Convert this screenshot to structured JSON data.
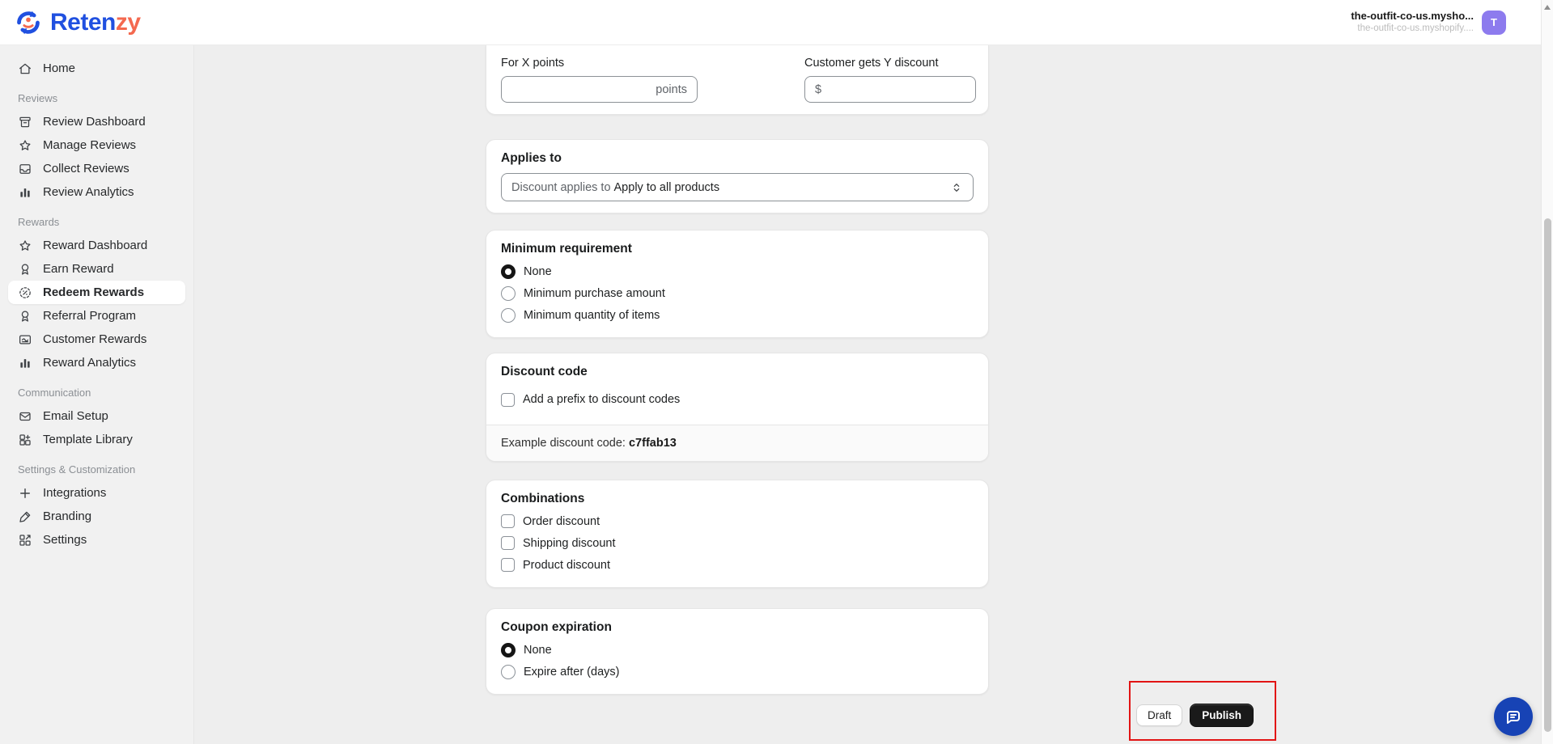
{
  "header": {
    "brand": {
      "name_primary": "Reten",
      "name_accent": "zy"
    },
    "shop": {
      "name": "the-outfit-co-us.mysho...",
      "domain": "the-outfit-co-us.myshopify....",
      "avatar_initial": "T"
    }
  },
  "sidebar": {
    "home": {
      "label": "Home",
      "icon": "home-icon"
    },
    "sections": [
      {
        "title": "Reviews",
        "items": [
          {
            "label": "Review Dashboard",
            "icon": "archive-icon"
          },
          {
            "label": "Manage Reviews",
            "icon": "star-icon"
          },
          {
            "label": "Collect Reviews",
            "icon": "inbox-icon"
          },
          {
            "label": "Review Analytics",
            "icon": "bar-chart-icon"
          }
        ]
      },
      {
        "title": "Rewards",
        "items": [
          {
            "label": "Reward Dashboard",
            "icon": "star-icon"
          },
          {
            "label": "Earn Reward",
            "icon": "award-icon"
          },
          {
            "label": "Redeem Rewards",
            "icon": "discount-circle-icon",
            "active": true
          },
          {
            "label": "Referral Program",
            "icon": "award-icon"
          },
          {
            "label": "Customer Rewards",
            "icon": "gift-card-icon"
          },
          {
            "label": "Reward Analytics",
            "icon": "bar-chart-icon"
          }
        ]
      },
      {
        "title": "Communication",
        "items": [
          {
            "label": "Email Setup",
            "icon": "envelope-icon"
          },
          {
            "label": "Template Library",
            "icon": "grid-plus-icon"
          }
        ]
      },
      {
        "title": "Settings & Customization",
        "items": [
          {
            "label": "Integrations",
            "icon": "plus-icon"
          },
          {
            "label": "Branding",
            "icon": "pen-icon"
          },
          {
            "label": "Settings",
            "icon": "grid-arrow-icon"
          }
        ]
      }
    ]
  },
  "form": {
    "points_field": {
      "label": "For X points",
      "value": "",
      "suffix": "points"
    },
    "discount_field": {
      "label": "Customer gets Y discount",
      "value": "",
      "prefix": "$"
    },
    "applies_to": {
      "heading": "Applies to",
      "select_prefix": "Discount applies to",
      "selected_option": "Apply to all products"
    },
    "minimum_requirement": {
      "heading": "Minimum requirement",
      "options": [
        {
          "label": "None",
          "selected": true
        },
        {
          "label": "Minimum purchase amount",
          "selected": false
        },
        {
          "label": "Minimum quantity of items",
          "selected": false
        }
      ]
    },
    "discount_code": {
      "heading": "Discount code",
      "checkbox_label": "Add a prefix to discount codes",
      "checked": false,
      "example_label": "Example discount code:",
      "example_code": "c7ffab13"
    },
    "combinations": {
      "heading": "Combinations",
      "options": [
        {
          "label": "Order discount",
          "checked": false
        },
        {
          "label": "Shipping discount",
          "checked": false
        },
        {
          "label": "Product discount",
          "checked": false
        }
      ]
    },
    "coupon_expiration": {
      "heading": "Coupon expiration",
      "options": [
        {
          "label": "None",
          "selected": true
        },
        {
          "label": "Expire after (days)",
          "selected": false
        }
      ]
    }
  },
  "actions": {
    "draft_label": "Draft",
    "publish_label": "Publish"
  },
  "colors": {
    "brand_blue": "#2050e0",
    "brand_coral": "#f4694f",
    "avatar_purple": "#8d7bee",
    "chat_fab_blue": "#1743b5",
    "annotation_red": "#e21414",
    "publish_black": "#1a1a1a"
  }
}
